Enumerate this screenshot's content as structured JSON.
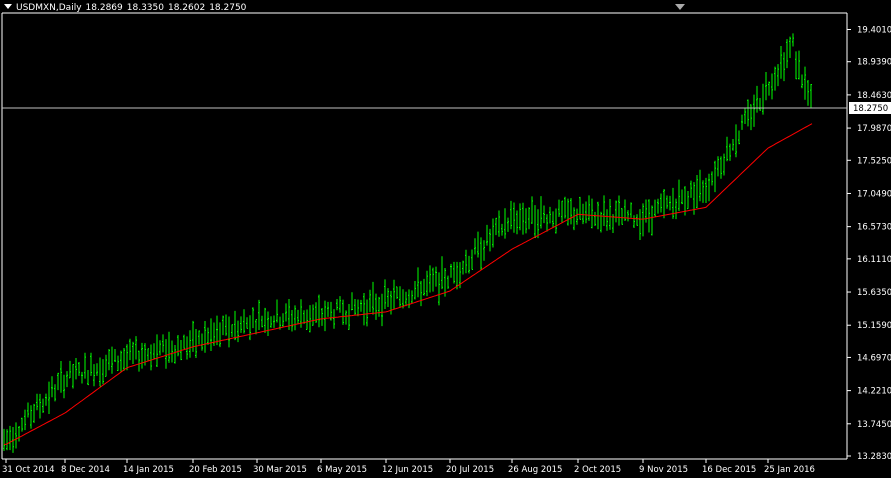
{
  "header": {
    "symbol": "USDMXN,Daily",
    "open": "18.2869",
    "high": "18.3350",
    "low": "18.2602",
    "close": "18.2750"
  },
  "colors": {
    "background": "#000000",
    "candles": "#00ff00",
    "moving_average": "#ff0000",
    "axis": "#ffffff",
    "price_line": "#c0c0c0",
    "current_price_bg": "#ffffff"
  },
  "chart_data": {
    "type": "line",
    "grid": false,
    "y_scale": [
      13.283,
      19.401
    ],
    "y_ticks": [
      "19.4010",
      "18.9390",
      "18.4630",
      "17.9870",
      "17.5250",
      "17.0490",
      "16.5730",
      "16.1110",
      "15.6350",
      "15.1590",
      "14.6970",
      "14.2210",
      "13.7450",
      "13.2830"
    ],
    "x_ticks": [
      "31 Oct 2014",
      "8 Dec 2014",
      "14 Jan 2015",
      "20 Feb 2015",
      "30 Mar 2015",
      "6 May 2015",
      "12 Jun 2015",
      "20 Jul 2015",
      "26 Aug 2015",
      "2 Oct 2015",
      "9 Nov 2015",
      "16 Dec 2015",
      "25 Jan 2016"
    ],
    "current_price": "18.2750",
    "series": [
      {
        "kind": "price-bars",
        "x": [
          "31 Oct 2014",
          "8 Dec 2014",
          "14 Jan 2015",
          "20 Feb 2015",
          "30 Mar 2015",
          "6 May 2015",
          "12 Jun 2015",
          "20 Jul 2015",
          "26 Aug 2015",
          "2 Oct 2015",
          "9 Nov 2015",
          "16 Dec 2015",
          "25 Jan 2016"
        ],
        "values": [
          13.5,
          14.4,
          14.7,
          14.9,
          15.25,
          15.3,
          15.5,
          15.85,
          16.7,
          16.75,
          16.7,
          17.15,
          18.6
        ]
      },
      {
        "kind": "moving-average",
        "x": [
          "31 Oct 2014",
          "8 Dec 2014",
          "14 Jan 2015",
          "20 Feb 2015",
          "30 Mar 2015",
          "6 May 2015",
          "12 Jun 2015",
          "20 Jul 2015",
          "26 Aug 2015",
          "2 Oct 2015",
          "9 Nov 2015",
          "16 Dec 2015",
          "25 Jan 2016"
        ],
        "values": [
          13.45,
          13.9,
          14.55,
          14.85,
          15.05,
          15.25,
          15.35,
          15.65,
          16.25,
          16.75,
          16.68,
          16.85,
          17.7
        ]
      }
    ]
  }
}
